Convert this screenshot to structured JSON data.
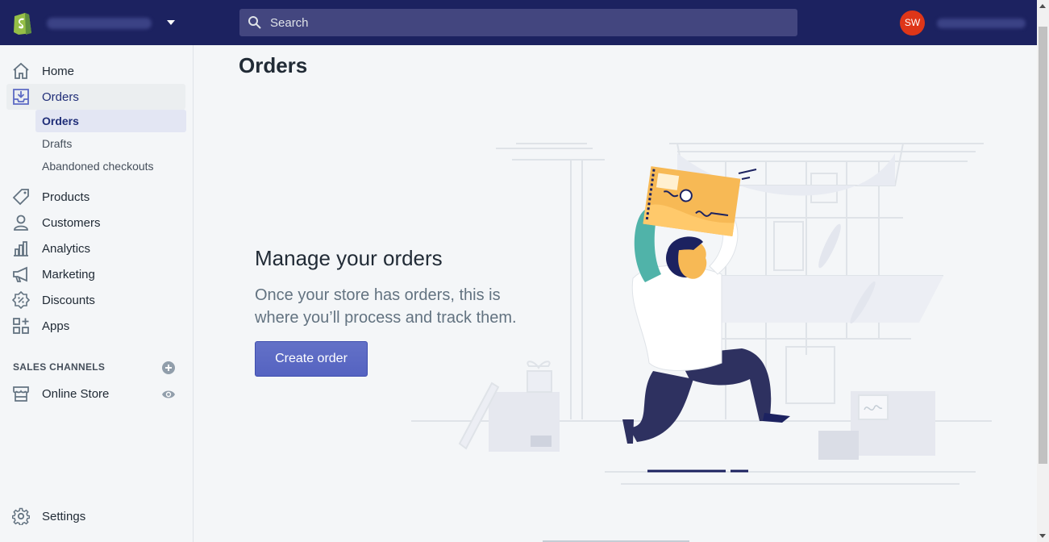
{
  "topbar": {
    "search_placeholder": "Search",
    "avatar_initials": "SW",
    "colors": {
      "background": "#1c2260",
      "avatar": "#de3618",
      "logo": "#95bf47"
    }
  },
  "sidebar": {
    "items": [
      {
        "label": "Home",
        "icon": "home-icon"
      },
      {
        "label": "Orders",
        "icon": "orders-icon"
      },
      {
        "label": "Products",
        "icon": "tag-icon"
      },
      {
        "label": "Customers",
        "icon": "person-icon"
      },
      {
        "label": "Analytics",
        "icon": "bar-chart-icon"
      },
      {
        "label": "Marketing",
        "icon": "megaphone-icon"
      },
      {
        "label": "Discounts",
        "icon": "discount-icon"
      },
      {
        "label": "Apps",
        "icon": "apps-icon"
      }
    ],
    "orders_sub": [
      {
        "label": "Orders"
      },
      {
        "label": "Drafts"
      },
      {
        "label": "Abandoned checkouts"
      }
    ],
    "sales_channels_label": "SALES CHANNELS",
    "online_store_label": "Online Store",
    "settings_label": "Settings"
  },
  "main": {
    "page_title": "Orders",
    "empty_state": {
      "heading": "Manage your orders",
      "description": "Once your store has orders, this is where you’ll process and track them.",
      "button_label": "Create order"
    },
    "accent_color": "#5c6ac4"
  }
}
